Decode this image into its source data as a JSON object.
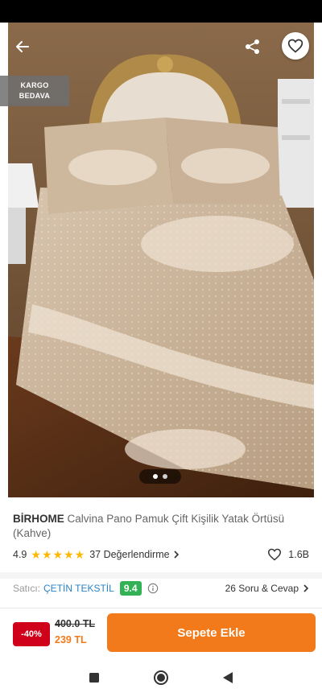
{
  "promo_badge": {
    "line1": "KARGO",
    "line2": "BEDAVA"
  },
  "product": {
    "brand": "BİRHOME",
    "name": "Calvina Pano Pamuk Çift Kişilik Yatak Örtüsü (Kahve)"
  },
  "rating": {
    "score": "4.9",
    "stars": 5,
    "reviews": "37 Değerlendirme",
    "likes": "1.6B"
  },
  "seller": {
    "label": "Satıcı:",
    "name": "ÇETİN TEKSTİL",
    "score": "9.4",
    "qa": "26 Soru & Cevap"
  },
  "pricing": {
    "discount": "-40%",
    "old_price": "400.0 TL",
    "new_price": "239 TL",
    "cart_button": "Sepete Ekle"
  },
  "gallery": {
    "current_index": 1,
    "total": 2
  },
  "colors": {
    "accent": "#f27a1a",
    "discount": "#d0021b",
    "seller": "#2a83c5",
    "score": "#33b255",
    "star": "#ffb800"
  }
}
